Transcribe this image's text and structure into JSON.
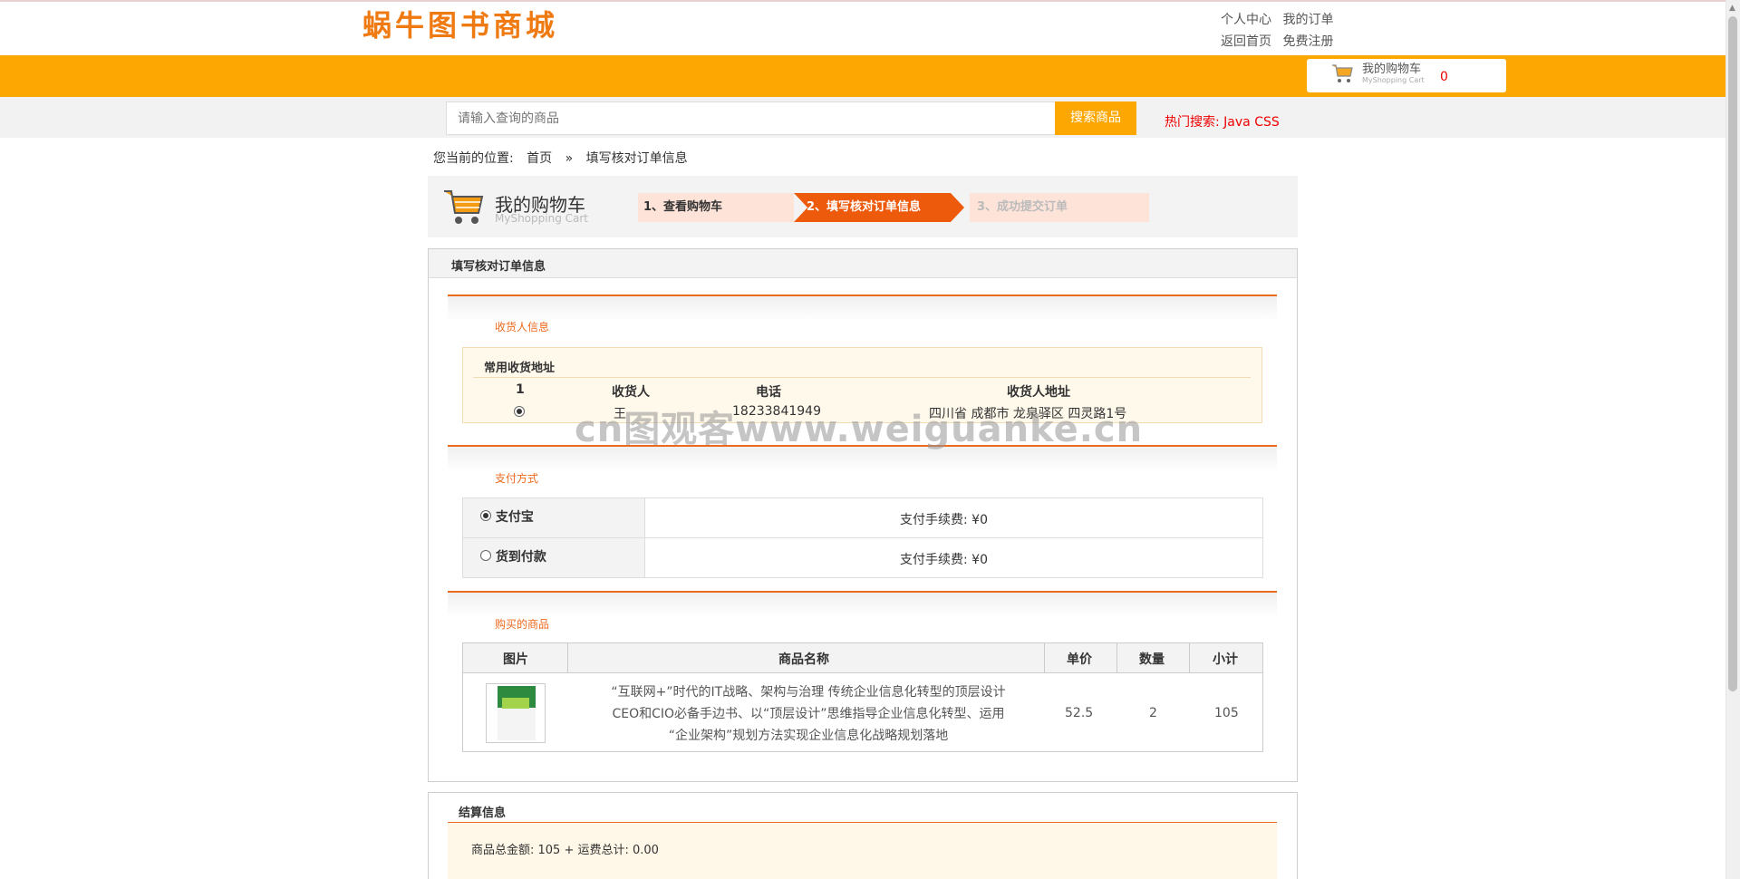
{
  "header": {
    "logo": "蜗牛图书商城",
    "links_row1": [
      "个人中心",
      "我的订单"
    ],
    "links_row2": [
      "返回首页",
      "免费注册"
    ],
    "cart_title": "我的购物车",
    "cart_sub": "MyShopping Cart",
    "cart_count": "0"
  },
  "search": {
    "placeholder": "请输入查询的商品",
    "button": "搜索商品",
    "hot": "热门搜索: Java CSS"
  },
  "breadcrumb": {
    "prefix": "您当前的位置:",
    "home": "首页",
    "sep": "»",
    "current": "填写核对订单信息"
  },
  "cart_band": {
    "title": "我的购物车",
    "subtitle": "MyShopping Cart",
    "steps": [
      "1、查看购物车",
      "2、填写核对订单信息",
      "3、成功提交订单"
    ]
  },
  "panel": {
    "title": "填写核对订单信息",
    "receiver_section": "收货人信息",
    "addr_head": "常用收货地址",
    "addr_columns": [
      "1",
      "收货人",
      "电话",
      "收货人地址"
    ],
    "addr_row": {
      "name": "王",
      "phone": "18233841949",
      "address": "四川省 成都市 龙泉驿区 四灵路1号"
    },
    "payment_section": "支付方式",
    "payments": [
      {
        "label": "支付宝",
        "fee": "支付手续费: ¥0",
        "selected": true
      },
      {
        "label": "货到付款",
        "fee": "支付手续费: ¥0",
        "selected": false
      }
    ],
    "goods_section": "购买的商品",
    "goods_columns": [
      "图片",
      "商品名称",
      "单价",
      "数量",
      "小计"
    ],
    "goods": [
      {
        "name_line1": "“互联网+”时代的IT战略、架构与治理 传统企业信息化转型的顶层设计",
        "name_line2": "CEO和CIO必备手边书、以“顶层设计”思维指导企业信息化转型、运用",
        "name_line3": "“企业架构”规划方法实现企业信息化战略规划落地",
        "price": "52.5",
        "qty": "2",
        "subtotal": "105"
      }
    ]
  },
  "settlement": {
    "title": "结算信息",
    "text": "商品总金额: 105 + 运费总计: 0.00"
  },
  "watermark": "cn图观客www.weiguanke.cn",
  "colors": {
    "brand_orange": "#fda802",
    "accent": "#ec6a1e",
    "red": "#ee0000"
  }
}
